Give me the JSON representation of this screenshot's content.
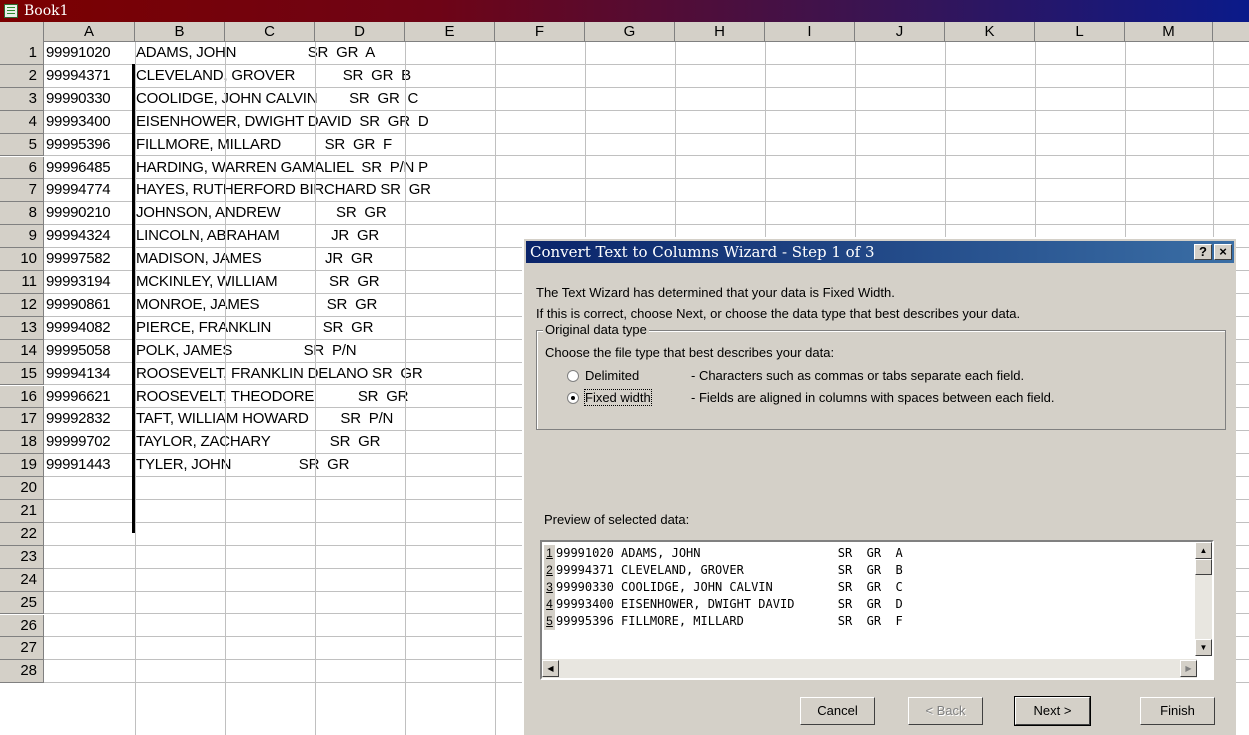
{
  "window": {
    "title": "Book1"
  },
  "columns": [
    "A",
    "B",
    "C",
    "D",
    "E",
    "F",
    "G",
    "H",
    "I",
    "J",
    "K",
    "L",
    "M"
  ],
  "rows": [
    {
      "n": "1",
      "id": "99991020",
      "text": "ADAMS, JOHN                  SR  GR  A"
    },
    {
      "n": "2",
      "id": "99994371",
      "text": "CLEVELAND, GROVER            SR  GR  B"
    },
    {
      "n": "3",
      "id": "99990330",
      "text": "COOLIDGE, JOHN CALVIN        SR  GR  C"
    },
    {
      "n": "4",
      "id": "99993400",
      "text": "EISENHOWER, DWIGHT DAVID  SR  GR  D"
    },
    {
      "n": "5",
      "id": "99995396",
      "text": "FILLMORE, MILLARD           SR  GR  F"
    },
    {
      "n": "6",
      "id": "99996485",
      "text": "HARDING, WARREN GAMALIEL  SR  P/N P"
    },
    {
      "n": "7",
      "id": "99994774",
      "text": "HAYES, RUTHERFORD BIRCHARD SR  GR"
    },
    {
      "n": "8",
      "id": "99990210",
      "text": "JOHNSON, ANDREW              SR  GR"
    },
    {
      "n": "9",
      "id": "99994324",
      "text": "LINCOLN, ABRAHAM             JR  GR"
    },
    {
      "n": "10",
      "id": "99997582",
      "text": "MADISON, JAMES                JR  GR"
    },
    {
      "n": "11",
      "id": "99993194",
      "text": "MCKINLEY, WILLIAM             SR  GR"
    },
    {
      "n": "12",
      "id": "99990861",
      "text": "MONROE, JAMES                 SR  GR"
    },
    {
      "n": "13",
      "id": "99994082",
      "text": "PIERCE, FRANKLIN             SR  GR"
    },
    {
      "n": "14",
      "id": "99995058",
      "text": "POLK, JAMES                  SR  P/N"
    },
    {
      "n": "15",
      "id": "99994134",
      "text": "ROOSEVELT, FRANKLIN DELANO SR  GR"
    },
    {
      "n": "16",
      "id": "99996621",
      "text": "ROOSEVELT, THEODORE           SR  GR"
    },
    {
      "n": "17",
      "id": "99992832",
      "text": "TAFT, WILLIAM HOWARD        SR  P/N"
    },
    {
      "n": "18",
      "id": "99999702",
      "text": "TAYLOR, ZACHARY               SR  GR"
    },
    {
      "n": "19",
      "id": "99991443",
      "text": "TYLER, JOHN                 SR  GR"
    },
    {
      "n": "20",
      "id": "",
      "text": ""
    },
    {
      "n": "21",
      "id": "",
      "text": ""
    },
    {
      "n": "22",
      "id": "",
      "text": ""
    },
    {
      "n": "23",
      "id": "",
      "text": ""
    },
    {
      "n": "24",
      "id": "",
      "text": ""
    },
    {
      "n": "25",
      "id": "",
      "text": ""
    },
    {
      "n": "26",
      "id": "",
      "text": ""
    },
    {
      "n": "27",
      "id": "",
      "text": ""
    },
    {
      "n": "28",
      "id": "",
      "text": ""
    }
  ],
  "dialog": {
    "title": "Convert Text to Columns Wizard - Step 1 of 3",
    "help_label": "?",
    "close_label": "×",
    "message1": "The Text Wizard has determined that your data is Fixed Width.",
    "message2": "If this is correct, choose Next, or choose the data type that best describes your data.",
    "group_label": "Original data type",
    "group_prompt": "Choose the file type that best describes your data:",
    "options": [
      {
        "label": "Delimited",
        "desc": "- Characters such as commas or tabs separate each field.",
        "checked": false
      },
      {
        "label": "Fixed width",
        "desc": "- Fields are aligned in columns with spaces between each field.",
        "checked": true
      }
    ],
    "preview_label": "Preview of selected data:",
    "preview_lines": [
      {
        "n": "1",
        "text": "99991020 ADAMS, JOHN                   SR  GR  A"
      },
      {
        "n": "2",
        "text": "99994371 CLEVELAND, GROVER             SR  GR  B"
      },
      {
        "n": "3",
        "text": "99990330 COOLIDGE, JOHN CALVIN         SR  GR  C"
      },
      {
        "n": "4",
        "text": "99993400 EISENHOWER, DWIGHT DAVID      SR  GR  D"
      },
      {
        "n": "5",
        "text": "99995396 FILLMORE, MILLARD             SR  GR  F"
      }
    ],
    "buttons": {
      "cancel": "Cancel",
      "back": "< Back",
      "next": "Next >",
      "finish": "Finish"
    }
  }
}
